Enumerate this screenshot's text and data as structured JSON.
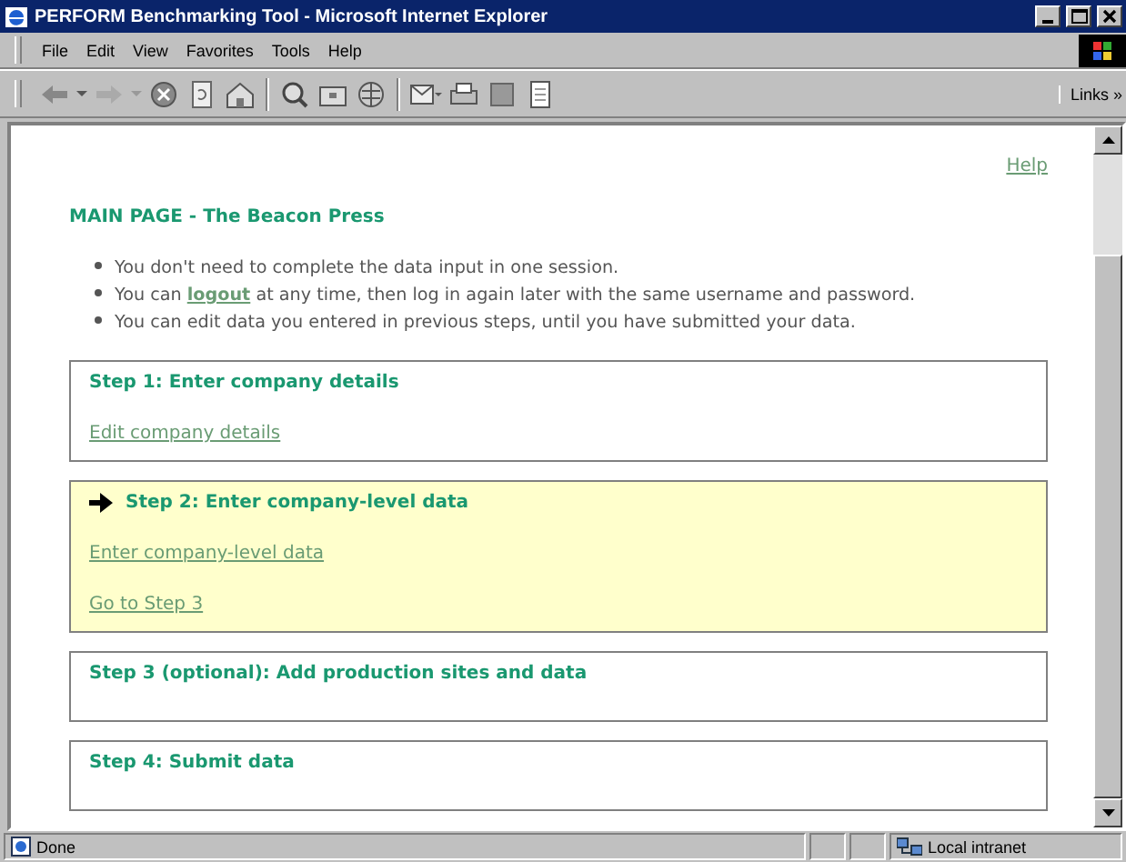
{
  "window": {
    "title": "PERFORM Benchmarking Tool - Microsoft Internet Explorer"
  },
  "menu": [
    {
      "label": "File"
    },
    {
      "label": "Edit"
    },
    {
      "label": "View"
    },
    {
      "label": "Favorites"
    },
    {
      "label": "Tools"
    },
    {
      "label": "Help"
    }
  ],
  "toolbar": {
    "links_label": "Links »"
  },
  "page": {
    "help_link": "Help",
    "heading": "MAIN PAGE - The Beacon Press",
    "bullets": [
      {
        "parts": [
          {
            "kind": "text",
            "text": "You don't need to complete the data input in one session."
          }
        ]
      },
      {
        "parts": [
          {
            "kind": "text",
            "text": "You can "
          },
          {
            "kind": "link",
            "text": "logout"
          },
          {
            "kind": "text",
            "text": " at any time, then log in again later with the same username and password."
          }
        ]
      },
      {
        "parts": [
          {
            "kind": "text",
            "text": "You can edit data you entered in previous steps, until you have submitted your data."
          }
        ]
      }
    ],
    "steps": [
      {
        "title": "Step 1: Enter company details",
        "current": false,
        "links": [
          "Edit company details"
        ]
      },
      {
        "title": "Step 2: Enter company-level data",
        "current": true,
        "links": [
          "Enter company-level data",
          "Go to Step 3"
        ]
      },
      {
        "title": "Step 3 (optional): Add production sites and data",
        "current": false
      },
      {
        "title": "Step 4: Submit data",
        "current": false
      }
    ]
  },
  "status_bar": {
    "status": "Done",
    "zone": "Local intranet"
  }
}
